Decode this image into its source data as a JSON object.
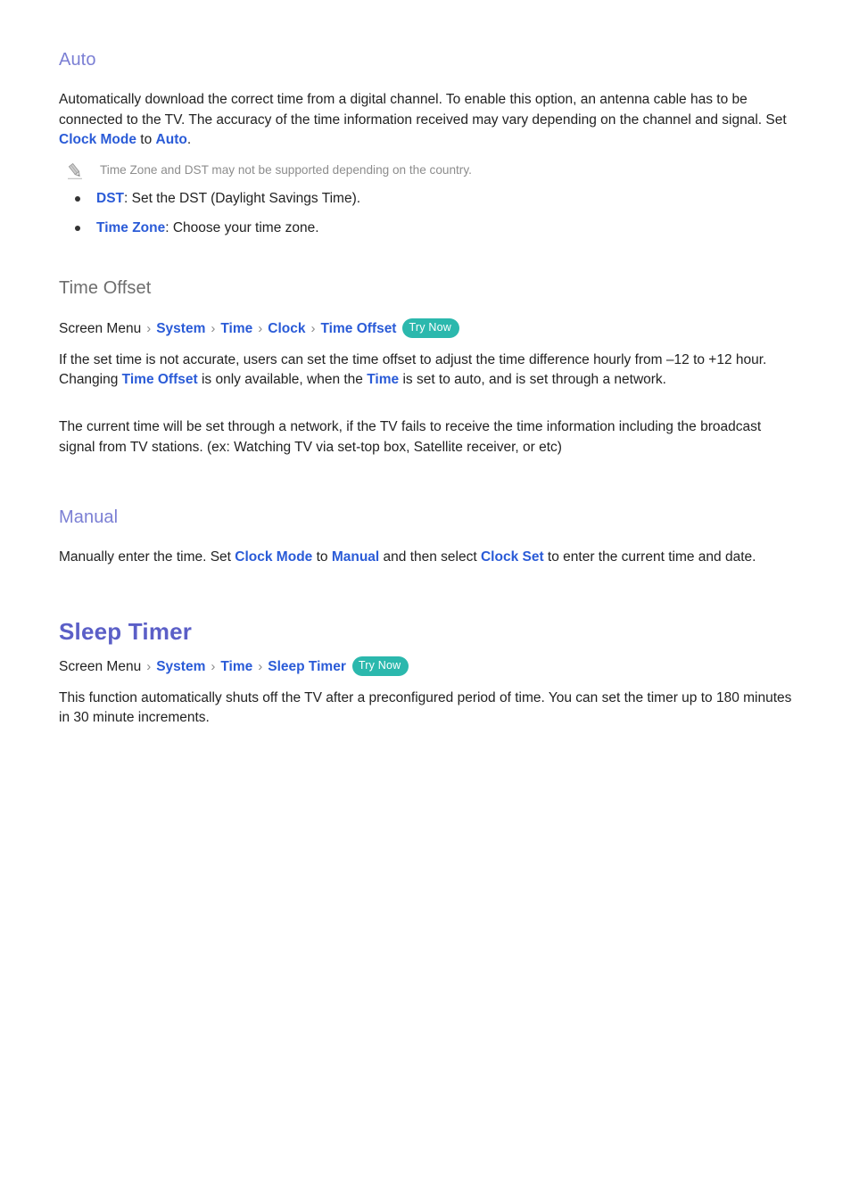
{
  "colors": {
    "heading_purple": "#7b7fd4",
    "heading_gray": "#6e6e6e",
    "title_indigo": "#5b5fc7",
    "link_blue": "#2a5bd7",
    "badge_teal": "#2bb8ad",
    "body_text": "#222222",
    "note_gray": "#8d8d8d",
    "page_background": "#ffffff"
  },
  "auto_section": {
    "heading": "Auto",
    "paragraph": {
      "part1": "Automatically download the correct time from a digital channel. To enable this option, an antenna cable has to be connected to the TV. The accuracy of the time information received may vary depending on the channel and signal. Set ",
      "link1": "Clock Mode",
      "part2": " to ",
      "link2": "Auto",
      "part3": "."
    },
    "note": {
      "icon": "pencil-icon",
      "text": "Time Zone and DST may not be supported depending on the country."
    },
    "bullets": [
      {
        "term": "DST",
        "description": ": Set the DST (Daylight Savings Time)."
      },
      {
        "term": "Time Zone",
        "description": ": Choose your time zone."
      }
    ]
  },
  "time_offset_section": {
    "heading": "Time Offset",
    "breadcrumb": {
      "root": "Screen Menu",
      "separator": "›",
      "items": [
        "System",
        "Time",
        "Clock",
        "Time Offset"
      ],
      "badge": "Try Now"
    },
    "paragraph1": {
      "part1": "If the set time is not accurate, users can set the time offset to adjust the time difference hourly from –12 to +12 hour. Changing ",
      "link1": "Time Offset",
      "part2": " is only available, when the ",
      "link2": "Time",
      "part3": " is set to auto, and is set through a network."
    },
    "paragraph2": "The current time will be set through a network, if the TV fails to receive the time information including the broadcast signal from TV stations. (ex: Watching TV via set-top box, Satellite receiver, or etc)"
  },
  "manual_section": {
    "heading": "Manual",
    "paragraph": {
      "part1": "Manually enter the time. Set ",
      "link1": "Clock Mode",
      "part2": " to ",
      "link2": "Manual",
      "part3": " and then select ",
      "link3": "Clock Set",
      "part4": " to enter the current time and date."
    }
  },
  "sleep_timer_section": {
    "title": "Sleep Timer",
    "breadcrumb": {
      "root": "Screen Menu",
      "separator": "›",
      "items": [
        "System",
        "Time",
        "Sleep Timer"
      ],
      "badge": "Try Now"
    },
    "paragraph": "This function automatically shuts off the TV after a preconfigured period of time. You can set the timer up to 180 minutes in 30 minute increments."
  }
}
